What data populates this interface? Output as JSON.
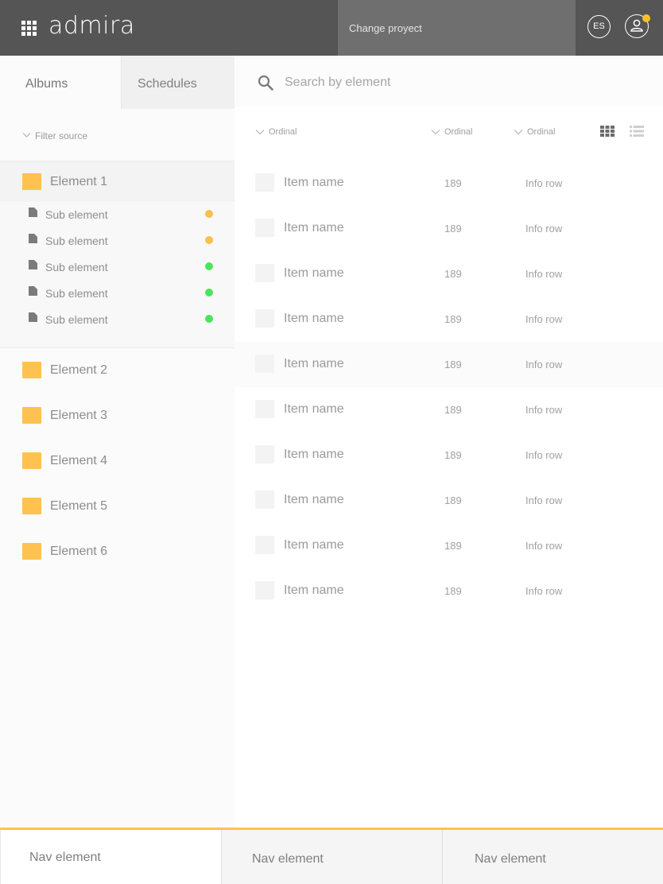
{
  "header": {
    "logo": "admira",
    "project_label": "Change proyect",
    "language": "ES"
  },
  "sidebar": {
    "tabs": [
      {
        "label": "Albums",
        "active": true
      },
      {
        "label": "Schedules",
        "active": false
      }
    ],
    "filter_label": "Filter source",
    "elements": [
      {
        "label": "Element 1",
        "expanded": true
      },
      {
        "label": "Element 2"
      },
      {
        "label": "Element 3"
      },
      {
        "label": "Element 4"
      },
      {
        "label": "Element 5"
      },
      {
        "label": "Element 6"
      }
    ],
    "sub_elements": [
      {
        "label": "Sub element",
        "status_color": "#f6c04e"
      },
      {
        "label": "Sub element",
        "status_color": "#f6c04e"
      },
      {
        "label": "Sub element",
        "status_color": "#4de45b"
      },
      {
        "label": "Sub element",
        "status_color": "#4de45b"
      },
      {
        "label": "Sub element",
        "status_color": "#4de45b"
      }
    ]
  },
  "search": {
    "placeholder": "Search by element",
    "value": ""
  },
  "table": {
    "columns": [
      "Ordinal",
      "Ordinal",
      "Ordinal"
    ],
    "rows": [
      {
        "name": "Item name",
        "number": "189",
        "info": "Info row"
      },
      {
        "name": "Item name",
        "number": "189",
        "info": "Info row"
      },
      {
        "name": "Item name",
        "number": "189",
        "info": "Info row"
      },
      {
        "name": "Item name",
        "number": "189",
        "info": "Info row"
      },
      {
        "name": "Item name",
        "number": "189",
        "info": "Info row"
      },
      {
        "name": "Item name",
        "number": "189",
        "info": "Info row"
      },
      {
        "name": "Item name",
        "number": "189",
        "info": "Info row"
      },
      {
        "name": "Item name",
        "number": "189",
        "info": "Info row"
      },
      {
        "name": "Item name",
        "number": "189",
        "info": "Info row"
      },
      {
        "name": "Item name",
        "number": "189",
        "info": "Info row"
      }
    ]
  },
  "view_toggle": {
    "icons": [
      "grid-view-icon",
      "list-view-icon"
    ],
    "active": "grid-view-icon"
  },
  "bottom_nav": {
    "items": [
      {
        "label": "Nav element"
      },
      {
        "label": "Nav element"
      },
      {
        "label": "Nav element"
      }
    ]
  },
  "colors": {
    "header_bg": "#555555",
    "project_bg": "#6f6f6f",
    "accent": "#ffc250",
    "notification_dot": "#f6c12a",
    "status_warning": "#f6c04e",
    "status_ok": "#4de45b"
  }
}
